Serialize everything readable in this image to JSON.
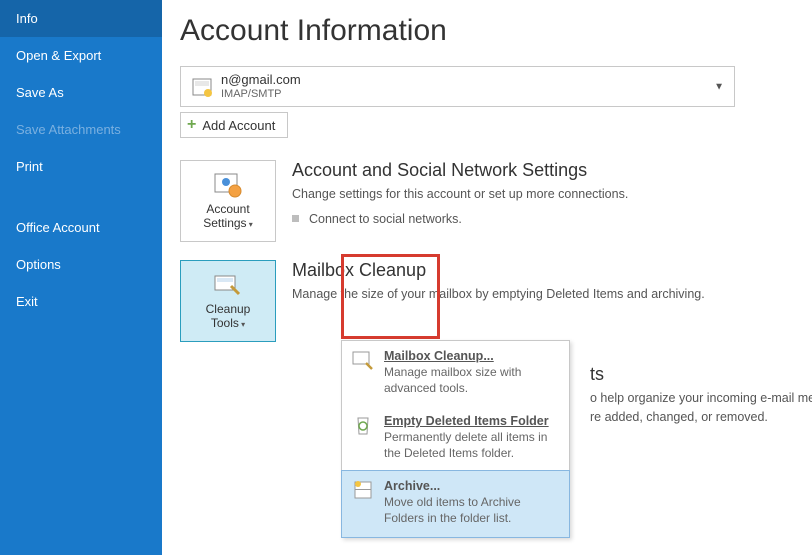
{
  "sidebar": {
    "items": [
      {
        "label": "Info",
        "state": "selected"
      },
      {
        "label": "Open & Export",
        "state": ""
      },
      {
        "label": "Save As",
        "state": ""
      },
      {
        "label": "Save Attachments",
        "state": "disabled"
      },
      {
        "label": "Print",
        "state": ""
      }
    ],
    "lower": [
      {
        "label": "Office Account"
      },
      {
        "label": "Options"
      },
      {
        "label": "Exit"
      }
    ]
  },
  "page": {
    "title": "Account Information"
  },
  "account": {
    "email_suffix": "n@gmail.com",
    "protocol": "IMAP/SMTP",
    "add_label": "Add Account"
  },
  "settings": {
    "button_line1": "Account",
    "button_line2": "Settings",
    "title": "Account and Social Network Settings",
    "desc": "Change settings for this account or set up more connections.",
    "bullet": "Connect to social networks."
  },
  "cleanup": {
    "button_line1": "Cleanup",
    "button_line2": "Tools",
    "title": "Mailbox Cleanup",
    "desc": "Manage the size of your mailbox by emptying Deleted Items and archiving."
  },
  "rules": {
    "title_suffix": "ts",
    "desc_line1": "o help organize your incoming e-mail messages, and receive",
    "desc_line2": "re added, changed, or removed."
  },
  "menu": {
    "mailbox_cleanup": {
      "title": "Mailbox Cleanup...",
      "desc": "Manage mailbox size with advanced tools."
    },
    "empty_deleted": {
      "title": "Empty Deleted Items Folder",
      "desc": "Permanently delete all items in the Deleted Items folder."
    },
    "archive": {
      "title": "Archive...",
      "desc": "Move old items to Archive Folders in the folder list."
    }
  }
}
